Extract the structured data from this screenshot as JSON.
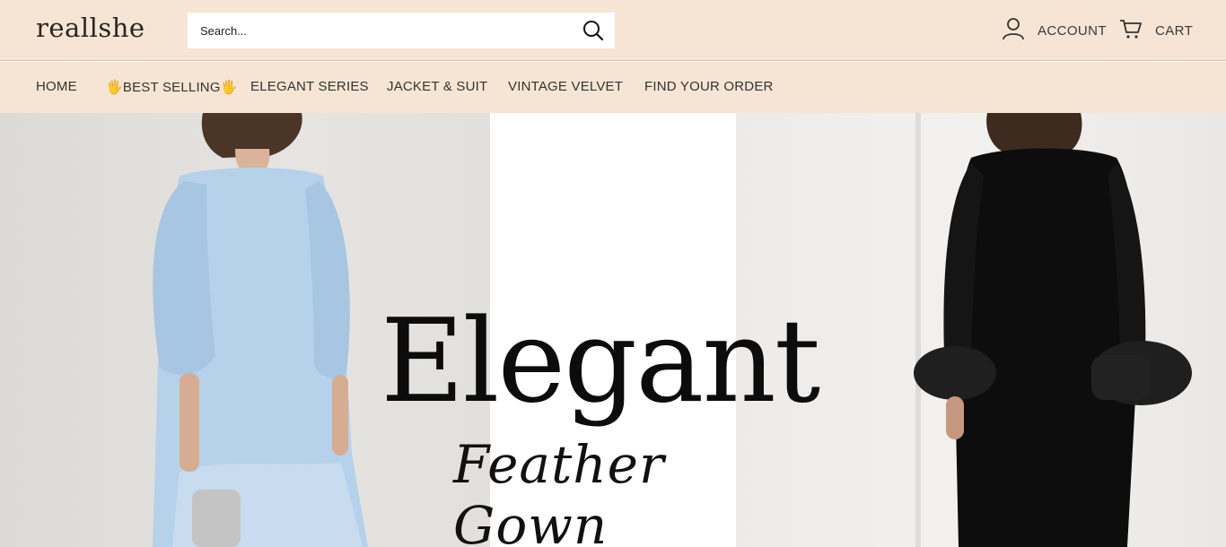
{
  "header": {
    "logo": "reallshe",
    "search_placeholder": "Search...",
    "account_label": "ACCOUNT",
    "cart_label": "CART"
  },
  "nav": {
    "items": [
      {
        "label": "HOME"
      },
      {
        "label": "🖐BEST SELLING🖐"
      },
      {
        "label": "ELEGANT SERIES"
      },
      {
        "label": "JACKET & SUIT"
      },
      {
        "label": "VINTAGE VELVET"
      },
      {
        "label": "FIND YOUR ORDER"
      }
    ]
  },
  "hero": {
    "title": "Elegant",
    "subtitle": "Feather Gown"
  },
  "colors": {
    "header_bg": "#f6e5d4",
    "text": "#2b2b2b"
  },
  "icons": [
    "search-icon",
    "account-icon",
    "cart-icon"
  ]
}
